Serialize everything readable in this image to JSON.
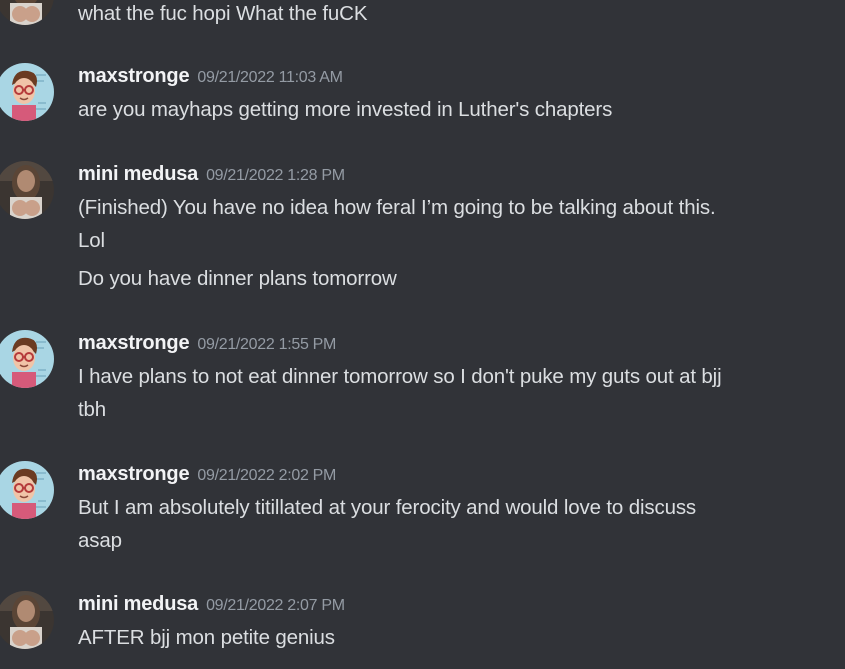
{
  "messages": [
    {
      "author": "",
      "avatar_icon": "woman-avatar-icon",
      "timestamp": "",
      "lines": [
        "what the fuc hopi What the fuCK"
      ]
    },
    {
      "author": "maxstronge",
      "avatar_icon": "cartoon-man-avatar-icon",
      "timestamp": "09/21/2022 11:03 AM",
      "lines": [
        "are you mayhaps getting more invested in Luther's chapters"
      ]
    },
    {
      "author": "mini medusa",
      "avatar_icon": "woman-avatar-icon",
      "timestamp": "09/21/2022 1:28 PM",
      "lines": [
        "(Finished) You have no idea how feral I’m going to be talking about this.",
        "Lol",
        "Do you have dinner plans tomorrow"
      ]
    },
    {
      "author": "maxstronge",
      "avatar_icon": "cartoon-man-avatar-icon",
      "timestamp": "09/21/2022 1:55 PM",
      "lines": [
        "I have plans to not eat dinner tomorrow so I don't puke my guts out at bjj",
        "tbh"
      ]
    },
    {
      "author": "maxstronge",
      "avatar_icon": "cartoon-man-avatar-icon",
      "timestamp": "09/21/2022 2:02 PM",
      "lines": [
        "But I am absolutely titillated at your ferocity and would love to discuss",
        "asap"
      ]
    },
    {
      "author": "mini medusa",
      "avatar_icon": "woman-avatar-icon",
      "timestamp": "09/21/2022 2:07 PM",
      "lines": [
        "AFTER bjj mon petite genius"
      ]
    }
  ]
}
